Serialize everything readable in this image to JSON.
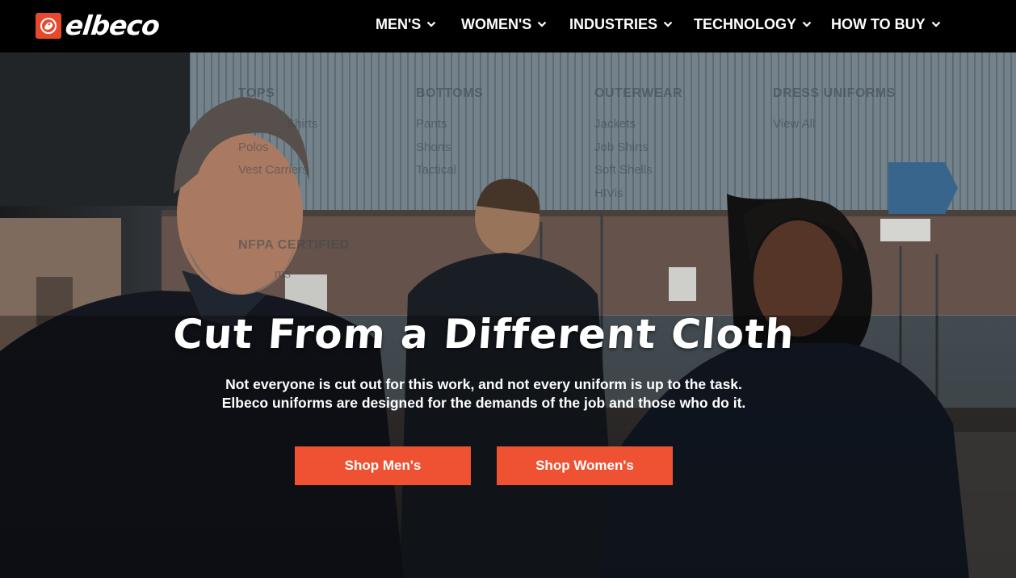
{
  "header": {
    "logo_text": "elbeco",
    "logo_icon": "lion-head-icon",
    "nav": [
      {
        "label": "MEN'S",
        "icon": "chevron-down-icon"
      },
      {
        "label": "WOMEN'S",
        "icon": "chevron-down-icon"
      },
      {
        "label": "INDUSTRIES",
        "icon": "chevron-down-icon"
      },
      {
        "label": "TECHNOLOGY",
        "icon": "chevron-down-icon"
      },
      {
        "label": "HOW TO BUY",
        "icon": "chevron-down-icon"
      }
    ]
  },
  "menu_ghost": {
    "col1_heading": "TOPS",
    "col1_items": [
      "Shirts",
      "Polos",
      "Vest Carriers"
    ],
    "col2_heading": "BOTTOMS",
    "col2_items": [
      "Pants",
      "Shorts",
      "Tactical"
    ],
    "col3_heading": "OUTERWEAR",
    "col3_items": [
      "Jackets",
      "Job Shirts",
      "Soft Shells",
      "HIVis"
    ],
    "col4_heading": "DRESS UNIFORMS",
    "col4_items": [
      "View All"
    ],
    "extra_heading": "NFPA CERTIFIED",
    "extra_item": "ms"
  },
  "hero": {
    "title": "Cut From a Different Cloth",
    "subtitle_line1": "Not everyone is cut out for this work, and not every uniform is up to the task.",
    "subtitle_line2": "Elbeco uniforms are designed for the demands of the job and those who do it.",
    "button_men": "Shop Men's",
    "button_women": "Shop Women's"
  },
  "colors": {
    "accent": "#ee5232",
    "logo_accent": "#e8492c",
    "header_bg": "#000000"
  }
}
